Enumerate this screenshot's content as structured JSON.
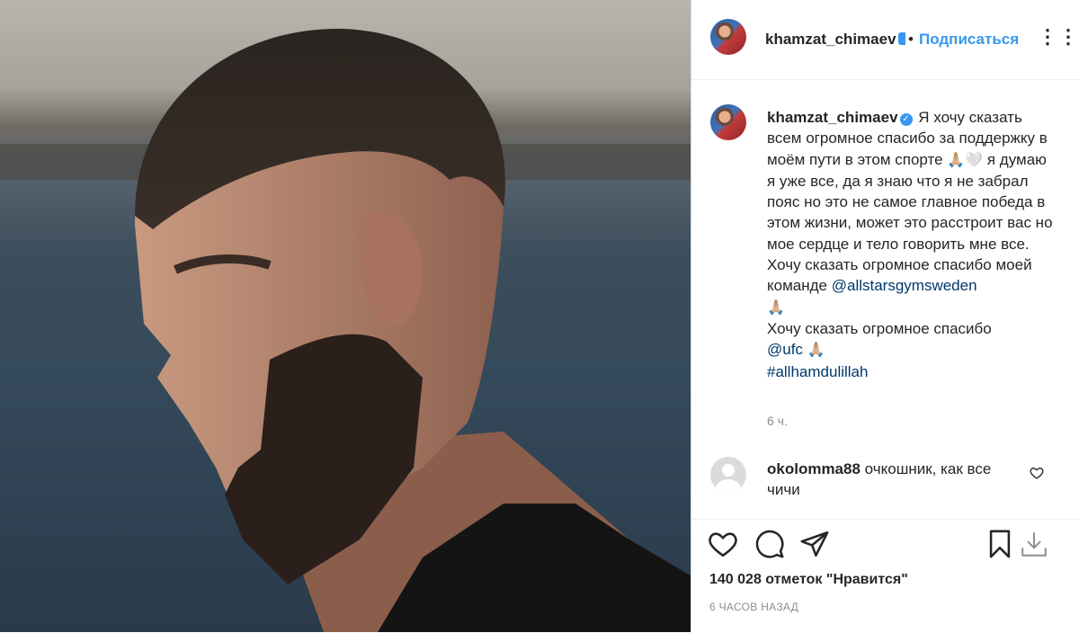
{
  "photo": {
    "alt_subject": "profile-photo"
  },
  "header": {
    "username": "khamzat_chimaev",
    "dot": "•",
    "follow_label": "Подписаться",
    "more_icon": "more-icon"
  },
  "caption": {
    "username": "khamzat_chimaev",
    "text_1": "Я хочу сказать всем огромное спасибо за поддержку в моём пути в этом спорте",
    "emoji_1": "🙏🏼🤍",
    "text_2": "я думаю я уже все, да я знаю что я не забрал пояс но это не самое главное победа в этом жизни, может это расстроит вас но мое сердце и тело говорить мне все. Хочу сказать огромное спасибо моей команде",
    "mention_1": "@allstarsgymsweden",
    "emoji_2": "🙏🏼",
    "text_3": "Хочу сказать огромное спасибо",
    "mention_2": "@ufc",
    "emoji_3": "🙏🏼",
    "hashtag": "#allhamdulillah",
    "time": "6 ч."
  },
  "comment": {
    "username": "okolomma88",
    "text": "очкошник, как все чичи"
  },
  "actions": {
    "like_icon": "heart-icon",
    "comment_icon": "comment-icon",
    "share_icon": "send-icon",
    "save_icon": "bookmark-icon",
    "download_icon": "download-icon"
  },
  "likes": "140 028 отметок \"Нравится\"",
  "posted": "6 часов назад",
  "colors": {
    "link": "#00376b",
    "accent": "#3897f0",
    "text": "#262626",
    "muted": "#8e8e8e"
  }
}
